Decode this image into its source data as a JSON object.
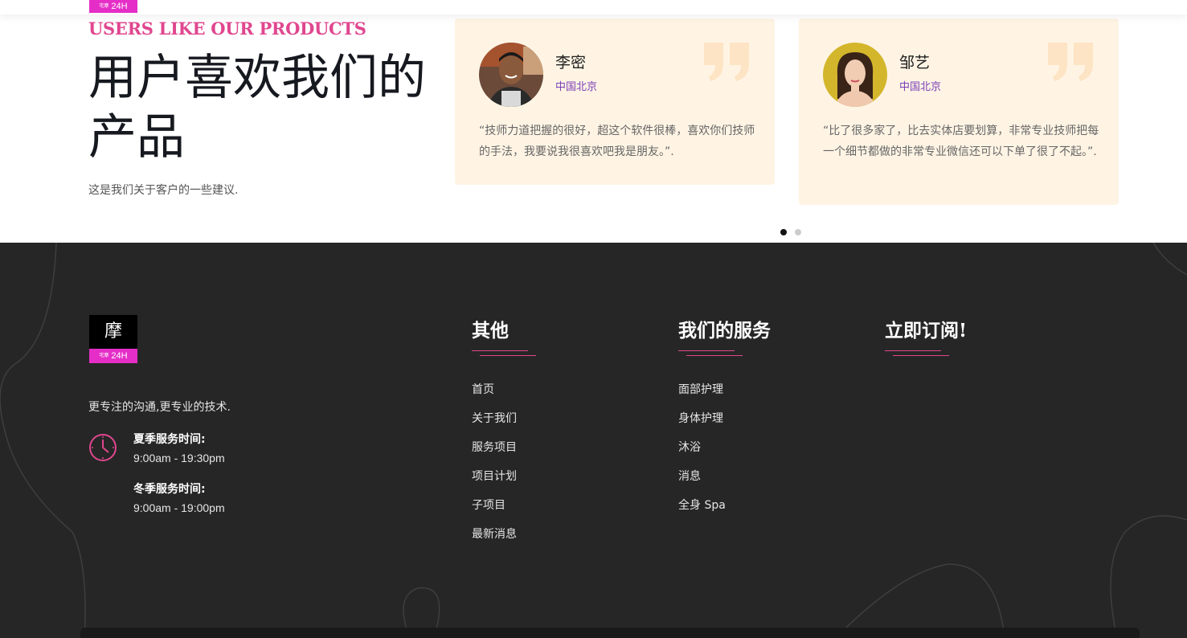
{
  "header": {
    "logo_text": "24H",
    "logo_small": "宅摩"
  },
  "testimonials": {
    "eyebrow": "USERS LIKE OUR PRODUCTS",
    "heading": "用户喜欢我们的产品",
    "subtext": "这是我们关于客户的一些建议.",
    "cards": [
      {
        "name": "李密",
        "location": "中国北京",
        "text": "“技师力道把握的很好，超这个软件很棒，喜欢你们技师的手法，我要说我很喜欢吧我是朋友。”."
      },
      {
        "name": "邹艺",
        "location": "中国北京",
        "text": "“比了很多家了，比去实体店要划算，非常专业技师把每一个细节都做的非常专业微信还可以下单了很了不起。”."
      }
    ],
    "active_slide": 1,
    "slide_count": 2
  },
  "footer": {
    "logo_glyph": "摩",
    "logo_text": "24H",
    "logo_small": "宅摩",
    "tagline": "更专注的沟通,更专业的技术.",
    "summer_label": "夏季服务时间:",
    "summer_time": "9:00am - 19:30pm",
    "winter_label": "冬季服务时间:",
    "winter_time": "9:00am - 19:00pm",
    "columns": [
      {
        "title": "其他",
        "links": [
          "首页",
          "关于我们",
          "服务项目",
          "项目计划",
          "子项目",
          "最新消息"
        ]
      },
      {
        "title": "我们的服务",
        "links": [
          "面部护理",
          "身体护理",
          "沐浴",
          "消息",
          "全身 Spa"
        ]
      },
      {
        "title": "立即订阅!",
        "links": []
      }
    ]
  },
  "colors": {
    "accent_pink": "#e0478f",
    "brand_magenta": "#e52ec7",
    "location_purple": "#7a3fb7",
    "card_bg": "#fff4e4",
    "footer_bg": "#262626"
  }
}
